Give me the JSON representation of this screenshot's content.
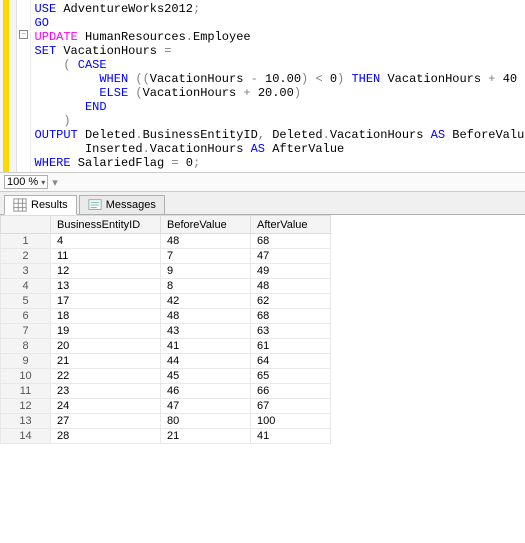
{
  "code": {
    "t_use": "USE",
    "t_db": " AdventureWorks2012",
    "t_semi": ";",
    "t_go": "GO",
    "t_update": "UPDATE",
    "t_table": " HumanResources",
    "t_dot": ".",
    "t_emp": "Employee",
    "t_set": "SET",
    "t_vac": " VacationHours ",
    "t_eq": "=",
    "t_open": "    ( ",
    "t_case": "CASE",
    "t_when": "         WHEN",
    "t_cond1a": " ((",
    "t_cond1b": "VacationHours ",
    "t_minus": "- ",
    "t_ten": "10.00",
    "t_cond1c": ") ",
    "t_lt": "< ",
    "t_zero": "0",
    "t_cond1d": ") ",
    "t_then": "THEN",
    "t_then_a": " VacationHours ",
    "t_plus": "+ ",
    "t_forty": "40",
    "t_else": "         ELSE",
    "t_else_a": " (",
    "t_else_b": "VacationHours ",
    "t_twenty": "20.00",
    "t_else_c": ")",
    "t_end": "       END",
    "t_close": "    )",
    "t_output": "OUTPUT",
    "t_out1": " Deleted",
    "t_out1b": "BusinessEntityID",
    "t_comma": ", ",
    "t_out2": "Deleted",
    "t_out2b": "VacationHours ",
    "t_as": "AS",
    "t_bv": " BeforeValue",
    "t_out3": "       Inserted",
    "t_out3b": "VacationHours ",
    "t_av": " AfterValue",
    "t_where": "WHERE",
    "t_wf": " SalariedFlag ",
    "t_zerob": "0"
  },
  "zoom": {
    "value": "100 %"
  },
  "tabs": {
    "results": "Results",
    "messages": "Messages"
  },
  "headers": {
    "c1": "BusinessEntityID",
    "c2": "BeforeValue",
    "c3": "AfterValue"
  },
  "rows": [
    {
      "n": "1",
      "a": "4",
      "b": "48",
      "c": "68"
    },
    {
      "n": "2",
      "a": "11",
      "b": "7",
      "c": "47"
    },
    {
      "n": "3",
      "a": "12",
      "b": "9",
      "c": "49"
    },
    {
      "n": "4",
      "a": "13",
      "b": "8",
      "c": "48"
    },
    {
      "n": "5",
      "a": "17",
      "b": "42",
      "c": "62"
    },
    {
      "n": "6",
      "a": "18",
      "b": "48",
      "c": "68"
    },
    {
      "n": "7",
      "a": "19",
      "b": "43",
      "c": "63"
    },
    {
      "n": "8",
      "a": "20",
      "b": "41",
      "c": "61"
    },
    {
      "n": "9",
      "a": "21",
      "b": "44",
      "c": "64"
    },
    {
      "n": "10",
      "a": "22",
      "b": "45",
      "c": "65"
    },
    {
      "n": "11",
      "a": "23",
      "b": "46",
      "c": "66"
    },
    {
      "n": "12",
      "a": "24",
      "b": "47",
      "c": "67"
    },
    {
      "n": "13",
      "a": "27",
      "b": "80",
      "c": "100"
    },
    {
      "n": "14",
      "a": "28",
      "b": "21",
      "c": "41"
    }
  ]
}
